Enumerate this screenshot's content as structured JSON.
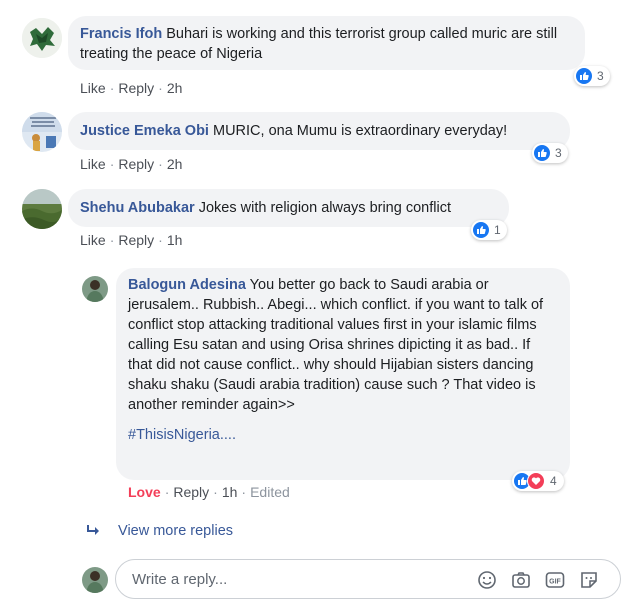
{
  "comments": [
    {
      "author": "Francis Ifoh",
      "text": "Buhari is working and this terrorist group called muric are still treating the peace of Nigeria",
      "like_label": "Like",
      "reply_label": "Reply",
      "time": "2h",
      "reaction_count": "3"
    },
    {
      "author": "Justice Emeka Obi",
      "text": "MURIC, ona Mumu is extraordinary everyday!",
      "like_label": "Like",
      "reply_label": "Reply",
      "time": "2h",
      "reaction_count": "3"
    },
    {
      "author": "Shehu Abubakar",
      "text": "Jokes with religion always bring conflict",
      "like_label": "Like",
      "reply_label": "Reply",
      "time": "1h",
      "reaction_count": "1"
    }
  ],
  "reply": {
    "author": "Balogun Adesina",
    "text": "You better go back to Saudi arabia or jerusalem.. Rubbish.. Abegi... which conflict. if you want to talk of conflict stop attacking traditional values first in your islamic films calling Esu satan and using Orisa shrines dipicting it as bad.. If that did not cause conflict.. why should Hijabian sisters dancing shaku shaku (Saudi arabia tradition) cause such ? That video is another reminder again>>",
    "hashtag": "#ThisisNigeria....",
    "love_label": "Love",
    "reply_label": "Reply",
    "time": "1h",
    "edited_label": "Edited",
    "reaction_count": "4"
  },
  "view_more_label": "View more replies",
  "composer": {
    "placeholder": "Write a reply..."
  },
  "colors": {
    "author": "#385898",
    "bubble": "#f2f3f5",
    "like_blue": "#1877f2",
    "love_red": "#f33e58",
    "love_label": "#f33e58"
  }
}
